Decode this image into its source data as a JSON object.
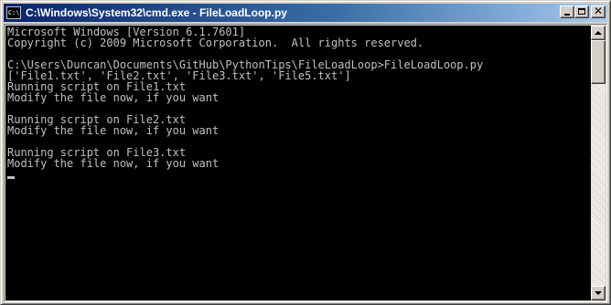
{
  "window": {
    "title": "C:\\Windows\\System32\\cmd.exe - FileLoadLoop.py",
    "icon": "cmd-icon",
    "icon_text": "C:\\",
    "controls": [
      "minimize-icon",
      "maximize-icon",
      "close-icon"
    ],
    "close_glyph": "✕"
  },
  "console": {
    "colors": {
      "background": "#000000",
      "text": "#c0c0c0"
    },
    "lines": [
      "Microsoft Windows [Version 6.1.7601]",
      "Copyright (c) 2009 Microsoft Corporation.  All rights reserved.",
      "",
      "C:\\Users\\Duncan\\Documents\\GitHub\\PythonTips\\FileLoadLoop>FileLoadLoop.py",
      "['File1.txt', 'File2.txt', 'File3.txt', 'File5.txt']",
      "Running script on File1.txt",
      "Modify the file now, if you want",
      "",
      "Running script on File2.txt",
      "Modify the file now, if you want",
      "",
      "Running script on File3.txt",
      "Modify the file now, if you want"
    ]
  }
}
